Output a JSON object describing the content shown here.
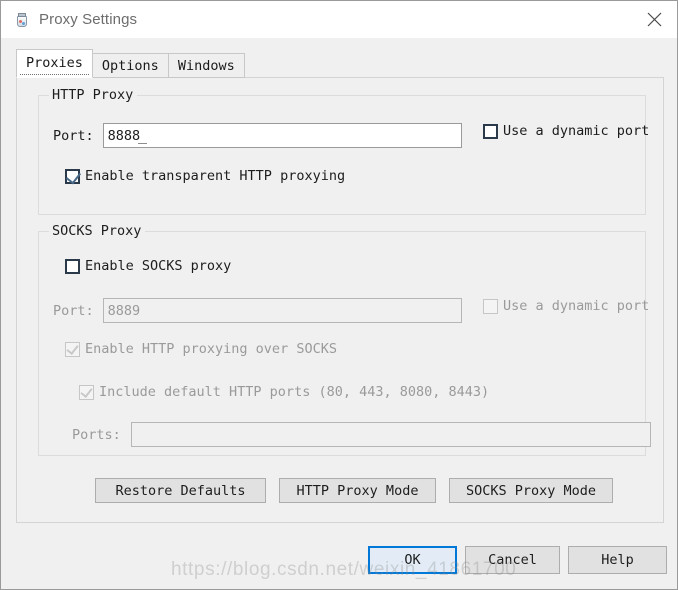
{
  "window": {
    "title": "Proxy Settings",
    "icon": "jar-icon",
    "close_icon": "close-icon"
  },
  "tabs": [
    {
      "label": "Proxies",
      "active": true
    },
    {
      "label": "Options",
      "active": false
    },
    {
      "label": "Windows",
      "active": false
    }
  ],
  "http_group": {
    "title": "HTTP Proxy",
    "port_label": "Port:",
    "port_value": "8888",
    "dynamic_port_label": "Use a dynamic port",
    "dynamic_port_checked": false,
    "transparent_label": "Enable transparent HTTP proxying",
    "transparent_checked": true
  },
  "socks_group": {
    "title": "SOCKS Proxy",
    "enable_label": "Enable SOCKS proxy",
    "enable_checked": false,
    "port_label": "Port:",
    "port_value": "8889",
    "dynamic_port_label": "Use a dynamic port",
    "dynamic_port_checked": false,
    "http_over_socks_label": "Enable HTTP proxying over SOCKS",
    "http_over_socks_checked": true,
    "include_default_ports_label": "Include default HTTP ports (80, 443, 8080, 8443)",
    "include_default_ports_checked": true,
    "ports_label": "Ports:",
    "ports_value": "",
    "ports_placeholder": ""
  },
  "mode_buttons": {
    "restore_defaults": "Restore Defaults",
    "http_proxy_mode": "HTTP Proxy Mode",
    "socks_proxy_mode": "SOCKS Proxy Mode"
  },
  "footer_buttons": {
    "ok": "OK",
    "cancel": "Cancel",
    "help": "Help"
  },
  "watermark": {
    "text": "https://blog.csdn.net/weixin_41861700"
  },
  "colors": {
    "accent": "#0078d7",
    "window_bg": "#f0f0f0",
    "titlebar_bg": "#ffffff",
    "text": "#1d1d1d",
    "disabled_text": "#9a9a9a"
  }
}
